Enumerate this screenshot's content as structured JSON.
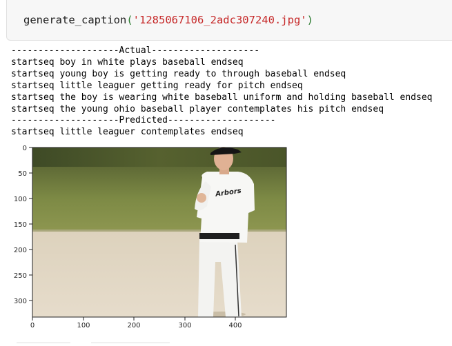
{
  "code_cell": {
    "function_name": "generate_caption",
    "open_paren": "(",
    "argument": "'1285067106_2adc307240.jpg'",
    "close_paren": ")"
  },
  "output": {
    "actual_header": "--------------------Actual--------------------",
    "actual_captions": [
      "startseq boy in white plays baseball endseq",
      "startseq young boy is getting ready to through baseball endseq",
      "startseq little leaguer getting ready for pitch endseq",
      "startseq the boy is wearing white baseball uniform and holding baseball endseq",
      "startseq the young ohio baseball player contemplates his pitch endseq"
    ],
    "predicted_header": "--------------------Predicted--------------------",
    "predicted_caption": "startseq little leaguer contemplates endseq"
  },
  "plot": {
    "y_ticks": [
      "0",
      "50",
      "100",
      "150",
      "200",
      "250",
      "300"
    ],
    "x_ticks": [
      "0",
      "100",
      "200",
      "300",
      "400"
    ],
    "jersey_text": "Arbors"
  }
}
